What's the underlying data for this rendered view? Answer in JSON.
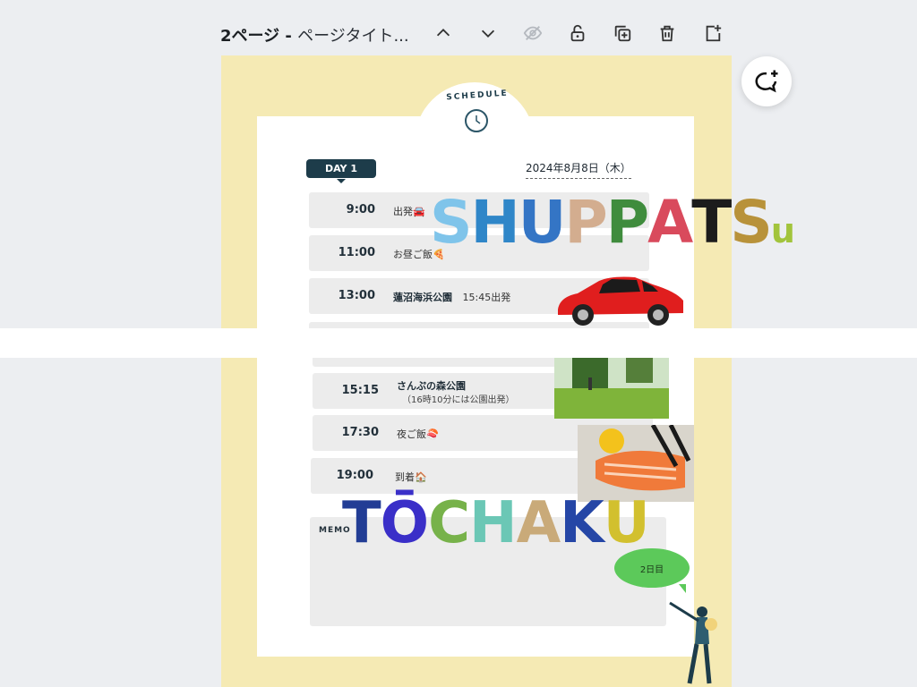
{
  "toolbar": {
    "page_label": "2ページ - ",
    "page_title": "ページタイト...",
    "buttons": [
      "chevron-up-icon",
      "chevron-down-icon",
      "eye-off-icon",
      "unlock-icon",
      "duplicate-icon",
      "trash-icon",
      "add-page-icon"
    ]
  },
  "schedule": {
    "header": "SCHEDULE",
    "day": "DAY 1",
    "date": "2024年8月8日（木）",
    "rows": [
      {
        "time": "9:00",
        "place": "出発🚘",
        "note": ""
      },
      {
        "time": "11:00",
        "place": "お昼ご飯🍕",
        "note": ""
      },
      {
        "time": "13:00",
        "place": "蓮沼海浜公園",
        "note": "15:45出発"
      },
      {
        "time": "15:15",
        "place": "さんぷの森公園",
        "note": "（16時10分には公園出発）"
      },
      {
        "time": "17:30",
        "place": "夜ご飯🍣",
        "note": ""
      },
      {
        "time": "19:00",
        "place": "到着🏠",
        "note": ""
      }
    ],
    "memo_label": "MEMO"
  },
  "decor": {
    "word1": [
      "S",
      "H",
      "U",
      "P",
      "P",
      "A",
      "T",
      "S",
      "u"
    ],
    "word1_colors": [
      "#7fc4ea",
      "#2f86c8",
      "#3475c5",
      "#d3ad8f",
      "#3f8c3d",
      "#d94a5c",
      "#1c1c1c",
      "#b8923a",
      "#a2c43c"
    ],
    "word2": [
      "T",
      "Ō",
      "C",
      "H",
      "A",
      "K",
      "U"
    ],
    "word2_colors": [
      "#223d95",
      "#3a2fc8",
      "#77b24a",
      "#6bc7b5",
      "#c9aa79",
      "#2546a6",
      "#d2c02e"
    ],
    "bubble_text": "2日目"
  },
  "colors": {
    "canvas_bg": "#f5eab4",
    "accent_dark": "#1d3c4a",
    "row_bg": "#ececec"
  }
}
